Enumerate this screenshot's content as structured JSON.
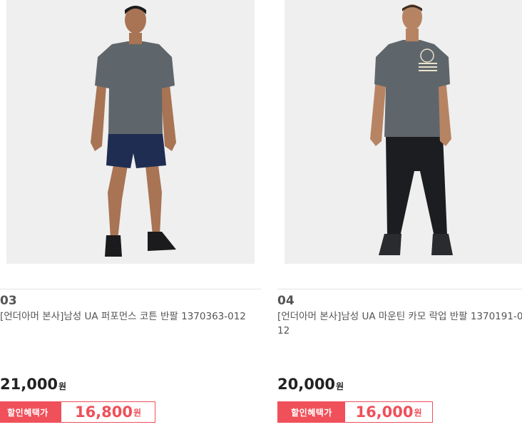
{
  "products": [
    {
      "number": "03",
      "title": "[언더아머 본사]남성 UA 퍼포먼스 코튼 반팔 1370363-012",
      "price": "21,000",
      "currency": "원",
      "sale_label": "할인혜택가",
      "sale_price": "16,800",
      "image_alt": "model-tee-shorts"
    },
    {
      "number": "04",
      "title": "[언더아머 본사]남성 UA 마운틴 카모 락업 반팔 1370191-012",
      "price": "20,000",
      "currency": "원",
      "sale_label": "할인혜택가",
      "sale_price": "16,000",
      "image_alt": "model-tee-pants"
    }
  ],
  "colors": {
    "accent": "#f0505a",
    "shirt": "#5f666b",
    "navy": "#1f2d52",
    "black": "#1c1d20"
  }
}
